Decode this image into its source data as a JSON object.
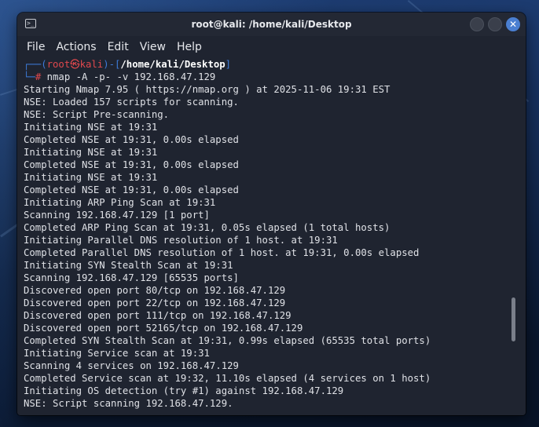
{
  "window": {
    "title": "root@kali: /home/kali/Desktop",
    "close_glyph": "✕"
  },
  "menu": [
    "File",
    "Actions",
    "Edit",
    "View",
    "Help"
  ],
  "prompt": {
    "corner_top": "┌──(",
    "user": "root",
    "at": "㉿",
    "host": "kali",
    "mid": ")-[",
    "path": "/home/kali/Desktop",
    "end": "]",
    "corner_bottom": "└─",
    "hash": "#",
    "command": " nmap -A -p- -v 192.168.47.129"
  },
  "output_lines": [
    "Starting Nmap 7.95 ( https://nmap.org ) at 2025-11-06 19:31 EST",
    "NSE: Loaded 157 scripts for scanning.",
    "NSE: Script Pre-scanning.",
    "Initiating NSE at 19:31",
    "Completed NSE at 19:31, 0.00s elapsed",
    "Initiating NSE at 19:31",
    "Completed NSE at 19:31, 0.00s elapsed",
    "Initiating NSE at 19:31",
    "Completed NSE at 19:31, 0.00s elapsed",
    "Initiating ARP Ping Scan at 19:31",
    "Scanning 192.168.47.129 [1 port]",
    "Completed ARP Ping Scan at 19:31, 0.05s elapsed (1 total hosts)",
    "Initiating Parallel DNS resolution of 1 host. at 19:31",
    "Completed Parallel DNS resolution of 1 host. at 19:31, 0.00s elapsed",
    "Initiating SYN Stealth Scan at 19:31",
    "Scanning 192.168.47.129 [65535 ports]",
    "Discovered open port 80/tcp on 192.168.47.129",
    "Discovered open port 22/tcp on 192.168.47.129",
    "Discovered open port 111/tcp on 192.168.47.129",
    "Discovered open port 52165/tcp on 192.168.47.129",
    "Completed SYN Stealth Scan at 19:31, 0.99s elapsed (65535 total ports)",
    "Initiating Service scan at 19:31",
    "Scanning 4 services on 192.168.47.129",
    "Completed Service scan at 19:32, 11.10s elapsed (4 services on 1 host)",
    "Initiating OS detection (try #1) against 192.168.47.129",
    "NSE: Script scanning 192.168.47.129."
  ],
  "colors": {
    "prompt_blue": "#3d7bd9",
    "prompt_red": "#e0484d",
    "terminal_bg": "#1f2430",
    "text": "#dfe1e6"
  }
}
